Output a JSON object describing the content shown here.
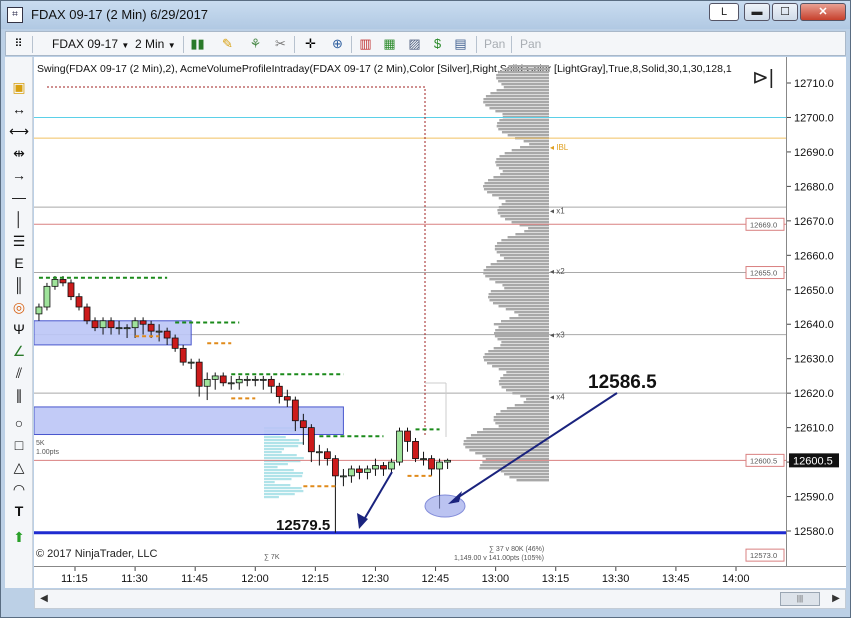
{
  "window": {
    "title": "FDAX 09-17 (2 Min)  6/29/2017",
    "app_icon": "chart-app-icon",
    "btn_l": "L",
    "btn_minimize": "▬",
    "btn_maximize": "☐",
    "btn_close": "✕"
  },
  "toolbar": {
    "instrument": "FDAX 09-17",
    "interval": "2 Min",
    "pan1": "Pan",
    "pan2": "Pan"
  },
  "indicator_label": "Swing(FDAX 09-17 (2 Min),2), AcmeVolumeProfileIntraday(FDAX 09-17 (2 Min),Color [Silver],Right,Solid,Color [LightGray],True,8,Solid,30,1,30,128,1",
  "copyright": "© 2017 NinjaTrader, LLC",
  "annotations": {
    "high_callout": "12586.5",
    "low_callout": "12579.5",
    "small_5k": "5K",
    "small_pts": "1.00pts",
    "volume_sum_1": "∑ 7K",
    "volume_sum_2": "∑ 37 v 80K (46%)",
    "volume_sum_3": "1,149.00 v 141.00pts (105%)"
  },
  "level_labels": {
    "ibl": "IBL",
    "x1": "x1",
    "x2": "x2",
    "x3": "x3",
    "x4": "x4"
  },
  "price_axis": {
    "ticks": [
      "12710.0",
      "12700.0",
      "12690.0",
      "12680.0",
      "12670.0",
      "12660.0",
      "12650.0",
      "12640.0",
      "12630.0",
      "12620.0",
      "12610.0",
      "12600.0",
      "12590.0",
      "12580.0"
    ],
    "marker_current": "12600.5",
    "marker_tags": [
      "12669.0",
      "12655.0",
      "12600.5",
      "12573.0"
    ]
  },
  "time_axis": {
    "ticks": [
      "11:15",
      "11:30",
      "11:45",
      "12:00",
      "12:15",
      "12:30",
      "12:45",
      "13:00",
      "13:15",
      "13:30",
      "13:45",
      "14:00"
    ]
  },
  "colors": {
    "up_candle": "#9fe39b",
    "down_candle": "#cc1b1b",
    "zone_fill": "#bcc6f7",
    "zone_border": "#3544c8",
    "profile": "#a8a8a8",
    "swing_high": "#1a8a1a",
    "swing_low": "#e08a1a",
    "callout_arrow": "#1a237e",
    "current_price_bg": "#111111"
  },
  "chart_data": {
    "type": "candlestick",
    "instrument": "FDAX 09-17",
    "interval": "2 Min",
    "x": [
      "11:06",
      "11:08",
      "11:10",
      "11:12",
      "11:14",
      "11:16",
      "11:18",
      "11:20",
      "11:22",
      "11:24",
      "11:26",
      "11:28",
      "11:30",
      "11:32",
      "11:34",
      "11:36",
      "11:38",
      "11:40",
      "11:42",
      "11:44",
      "11:46",
      "11:48",
      "11:50",
      "11:52",
      "11:54",
      "11:56",
      "11:58",
      "12:00",
      "12:02",
      "12:04",
      "12:06",
      "12:08",
      "12:10",
      "12:12",
      "12:14",
      "12:16",
      "12:18",
      "12:20",
      "12:22",
      "12:24",
      "12:26",
      "12:28",
      "12:30",
      "12:32",
      "12:34",
      "12:36",
      "12:38",
      "12:40",
      "12:42",
      "12:44",
      "12:46",
      "12:48"
    ],
    "open": [
      12643.0,
      12645.0,
      12651.0,
      12653.0,
      12652.0,
      12648.0,
      12645.0,
      12641.0,
      12639.0,
      12641.0,
      12639.0,
      12639.0,
      12639.0,
      12641.0,
      12640.0,
      12638.0,
      12638.0,
      12636.0,
      12633.0,
      12629.0,
      12629.0,
      12622.0,
      12624.0,
      12625.0,
      12623.0,
      12623.0,
      12624.0,
      12624.0,
      12624.0,
      12624.0,
      12622.0,
      12619.0,
      12618.0,
      12612.0,
      12610.0,
      12603.0,
      12603.0,
      12601.0,
      12596.0,
      12596.0,
      12598.0,
      12597.0,
      12598.0,
      12599.0,
      12598.0,
      12600.0,
      12609.0,
      12606.0,
      12601.0,
      12601.0,
      12598.0,
      12600.0
    ],
    "close": [
      12645.0,
      12651.0,
      12653.0,
      12652.0,
      12648.0,
      12645.0,
      12641.0,
      12639.0,
      12641.0,
      12639.0,
      12639.0,
      12639.0,
      12641.0,
      12640.0,
      12638.0,
      12638.0,
      12636.0,
      12633.0,
      12629.0,
      12629.0,
      12622.0,
      12624.0,
      12625.0,
      12623.0,
      12623.0,
      12624.0,
      12624.0,
      12624.0,
      12624.0,
      12622.0,
      12619.0,
      12618.0,
      12612.0,
      12610.0,
      12603.0,
      12603.0,
      12601.0,
      12596.0,
      12596.0,
      12598.0,
      12597.0,
      12598.0,
      12599.0,
      12598.0,
      12600.0,
      12609.0,
      12606.0,
      12601.0,
      12601.0,
      12598.0,
      12600.0,
      12600.5
    ],
    "high": [
      12646.0,
      12652.0,
      12654.0,
      12654.0,
      12653.0,
      12649.0,
      12646.0,
      12642.0,
      12642.0,
      12642.0,
      12641.0,
      12640.0,
      12642.0,
      12642.0,
      12641.0,
      12640.0,
      12639.0,
      12637.0,
      12634.0,
      12630.0,
      12630.0,
      12626.0,
      12626.0,
      12626.0,
      12625.0,
      12625.0,
      12625.0,
      12625.0,
      12625.0,
      12625.0,
      12623.0,
      12621.0,
      12619.0,
      12614.0,
      12611.0,
      12605.0,
      12604.0,
      12602.0,
      12598.0,
      12599.0,
      12599.0,
      12599.0,
      12601.0,
      12600.0,
      12601.0,
      12610.0,
      12610.0,
      12607.0,
      12603.0,
      12602.0,
      12601.0,
      12601.0
    ],
    "low": [
      12641.0,
      12644.0,
      12650.0,
      12651.0,
      12647.0,
      12644.0,
      12640.0,
      12638.0,
      12637.0,
      12637.0,
      12637.0,
      12636.0,
      12636.0,
      12637.0,
      12636.0,
      12635.0,
      12634.0,
      12632.0,
      12628.0,
      12627.0,
      12619.0,
      12618.0,
      12621.0,
      12622.0,
      12621.0,
      12621.0,
      12622.0,
      12622.0,
      12621.0,
      12620.0,
      12617.0,
      12616.0,
      12609.0,
      12605.0,
      12600.0,
      12599.0,
      12599.0,
      12579.5,
      12593.0,
      12594.0,
      12595.0,
      12595.0,
      12596.0,
      12596.0,
      12597.0,
      12599.0,
      12603.0,
      12600.0,
      12599.0,
      12596.0,
      12586.5,
      12598.0
    ],
    "price_axis_range": [
      12570.0,
      12714.0
    ],
    "horizontal_levels": [
      {
        "price": 12700.0,
        "color": "#5bd0e8"
      },
      {
        "price": 12694.0,
        "color": "#f0c060"
      },
      {
        "price": 12674.0,
        "color": "#a9a9a9"
      },
      {
        "price": 12669.0,
        "color": "#d98080"
      },
      {
        "price": 12655.0,
        "color": "#d98080"
      },
      {
        "price": 12655.0,
        "color": "#a9a9a9"
      },
      {
        "price": 12637.0,
        "color": "#a9a9a9"
      },
      {
        "price": 12620.0,
        "color": "#a9a9a9"
      },
      {
        "price": 12600.5,
        "color": "#d98080"
      },
      {
        "price": 12579.5,
        "color": "#1f2bd0"
      }
    ],
    "zones": [
      {
        "from": "11:04",
        "to": "11:44",
        "low": 12634.0,
        "high": 12641.0
      },
      {
        "from": "11:04",
        "to": "12:22",
        "low": 12608.0,
        "high": 12616.0
      }
    ]
  }
}
